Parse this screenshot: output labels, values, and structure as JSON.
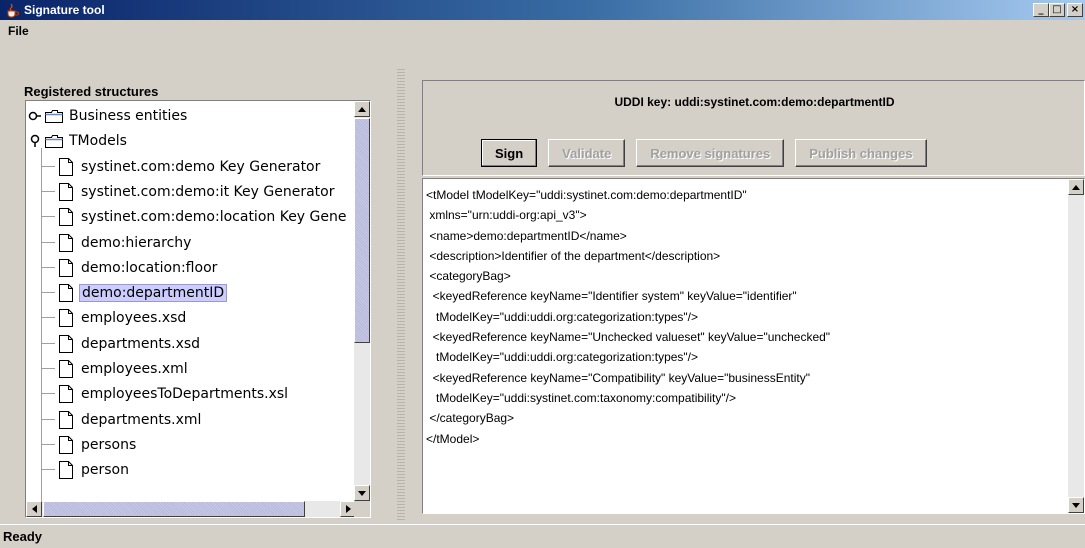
{
  "window": {
    "title": "Signature tool",
    "controls": {
      "minimize": "_",
      "maximize": "□",
      "close": "×"
    }
  },
  "menu": {
    "file": "File"
  },
  "left": {
    "heading": "Registered structures",
    "tree": [
      {
        "label": "Business entities",
        "type": "folder",
        "expanded": false
      },
      {
        "label": "TModels",
        "type": "folder",
        "expanded": true
      },
      {
        "label": "systinet.com:demo Key Generator",
        "type": "doc"
      },
      {
        "label": "systinet.com:demo:it Key Generator",
        "type": "doc"
      },
      {
        "label": "systinet.com:demo:location Key Gene",
        "type": "doc"
      },
      {
        "label": "demo:hierarchy",
        "type": "doc"
      },
      {
        "label": "demo:location:floor",
        "type": "doc"
      },
      {
        "label": "demo:departmentID",
        "type": "doc",
        "selected": true
      },
      {
        "label": "employees.xsd",
        "type": "doc"
      },
      {
        "label": "departments.xsd",
        "type": "doc"
      },
      {
        "label": "employees.xml",
        "type": "doc"
      },
      {
        "label": "employeesToDepartments.xsl",
        "type": "doc"
      },
      {
        "label": "departments.xml",
        "type": "doc"
      },
      {
        "label": "persons",
        "type": "doc"
      },
      {
        "label": "person",
        "type": "doc"
      }
    ]
  },
  "right": {
    "uddi_key_label": "UDDI key:  uddi:systinet.com:demo:departmentID",
    "buttons": {
      "sign": "Sign",
      "validate": "Validate",
      "remove": "Remove signatures",
      "publish": "Publish changes"
    },
    "xml_lines": [
      "<tModel tModelKey=\"uddi:systinet.com:demo:departmentID\"",
      " xmlns=\"urn:uddi-org:api_v3\">",
      " <name>demo:departmentID</name>",
      " <description>Identifier of the department</description>",
      " <categoryBag>",
      "  <keyedReference keyName=\"Identifier system\" keyValue=\"identifier\"",
      "   tModelKey=\"uddi:uddi.org:categorization:types\"/>",
      "  <keyedReference keyName=\"Unchecked valueset\" keyValue=\"unchecked\"",
      "   tModelKey=\"uddi:uddi.org:categorization:types\"/>",
      "  <keyedReference keyName=\"Compatibility\" keyValue=\"businessEntity\"",
      "   tModelKey=\"uddi:systinet.com:taxonomy:compatibility\"/>",
      " </categoryBag>",
      "</tModel>"
    ]
  },
  "status": {
    "text": "Ready"
  },
  "colors": {
    "titlebar": "#0a246a",
    "selection": "#ccccff",
    "background": "#d4d0c8"
  }
}
